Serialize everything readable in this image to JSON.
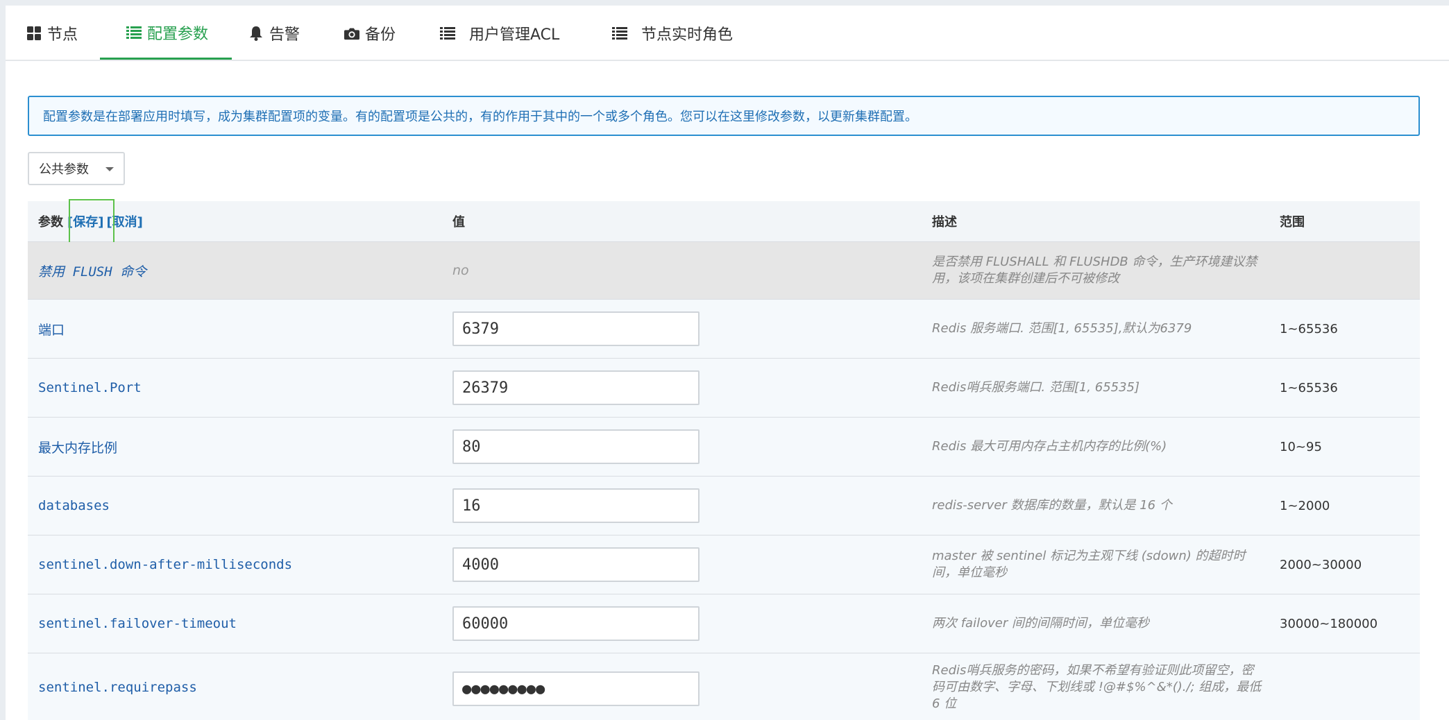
{
  "tabs": [
    {
      "label": "节点",
      "icon": "grid-icon"
    },
    {
      "label": "配置参数",
      "icon": "list-icon",
      "active": true
    },
    {
      "label": "告警",
      "icon": "bell-icon"
    },
    {
      "label": "备份",
      "icon": "camera-icon"
    },
    {
      "label": "用户管理ACL",
      "icon": "list-icon"
    },
    {
      "label": "节点实时角色",
      "icon": "list-icon"
    }
  ],
  "info_text": "配置参数是在部署应用时填写，成为集群配置项的变量。有的配置项是公共的，有的作用于其中的一个或多个角色。您可以在这里修改参数，以更新集群配置。",
  "select": {
    "value": "公共参数"
  },
  "table": {
    "headers": {
      "param": "参数",
      "save": "[保存]",
      "cancel": "[取消]",
      "value": "值",
      "desc": "描述",
      "range": "范围"
    },
    "rows": [
      {
        "name": "禁用 FLUSH 命令",
        "value": "no",
        "desc": "是否禁用 FLUSHALL 和 FLUSHDB 命令，生产环境建议禁用，该项在集群创建后不可被修改",
        "range": ""
      },
      {
        "name": "端口",
        "value": "6379",
        "desc": "Redis 服务端口. 范围[1, 65535],默认为6379",
        "range": "1~65536"
      },
      {
        "name": "Sentinel.Port",
        "value": "26379",
        "desc": "Redis哨兵服务端口. 范围[1, 65535]",
        "range": "1~65536"
      },
      {
        "name": "最大内存比例",
        "value": "80",
        "desc": "Redis 最大可用内存占主机内存的比例(%)",
        "range": "10~95"
      },
      {
        "name": "databases",
        "value": "16",
        "desc": "redis-server 数据库的数量，默认是 16 个",
        "range": "1~2000"
      },
      {
        "name": "sentinel.down-after-milliseconds",
        "value": "4000",
        "desc": "master 被 sentinel 标记为主观下线 (sdown) 的超时时间，单位毫秒",
        "range": "2000~30000"
      },
      {
        "name": "sentinel.failover-timeout",
        "value": "60000",
        "desc": "两次 failover 间的间隔时间，单位毫秒",
        "range": "30000~180000"
      },
      {
        "name": "sentinel.requirepass",
        "value": "●●●●●●●●●",
        "desc": "Redis哨兵服务的密码，如果不希望有验证则此项留空，密码可由数字、字母、下划线或 !@#$%^&*()./; 组成，最低 6 位",
        "range": ""
      }
    ]
  },
  "colors": {
    "accent": "#27a04f",
    "link": "#1f6fb4",
    "info_border": "#2b8fd0"
  }
}
